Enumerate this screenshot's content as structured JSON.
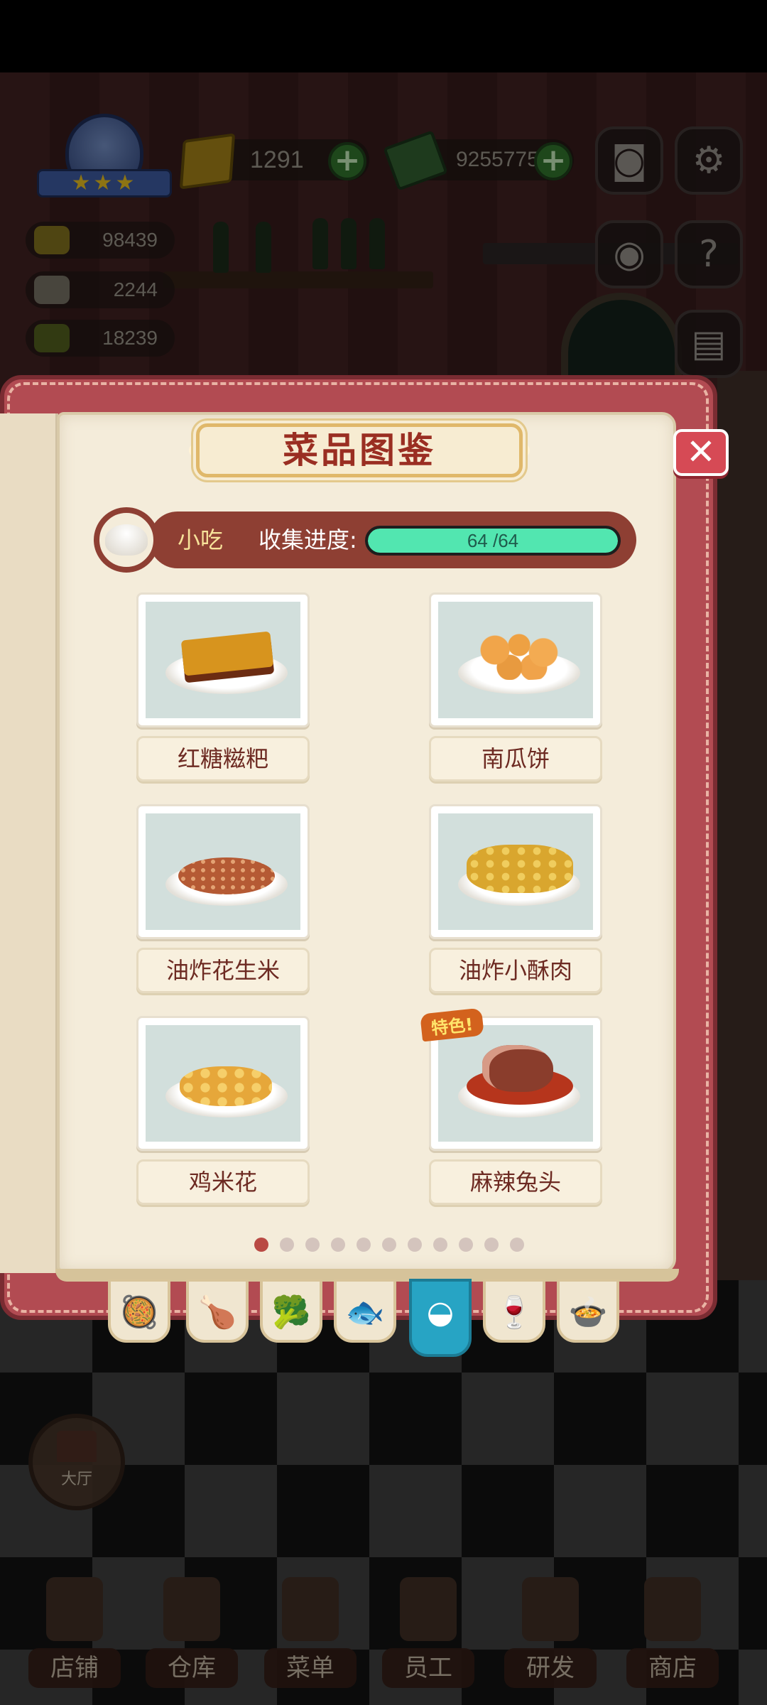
{
  "hud": {
    "gold": "1291",
    "cash": "9255775",
    "stats": [
      "98439",
      "2244",
      "18239"
    ],
    "badge_stars": "★★★",
    "icons": [
      "camera-icon",
      "gear-icon",
      "eye-icon",
      "help-book-icon",
      "recipe-book-icon"
    ]
  },
  "book": {
    "title": "菜品图鉴",
    "close": "✕",
    "category": "小吃",
    "progress_label": "收集进度:",
    "progress_current": "64",
    "progress_total": " /64",
    "progress_fraction": 1.0,
    "special_tag": "特色!",
    "dishes": [
      "红糖糍粑",
      "南瓜饼",
      "油炸花生米",
      "油炸小酥肉",
      "鸡米花",
      "麻辣兔头"
    ],
    "page_count": 11,
    "active_page": 1,
    "tabs": [
      {
        "icon": "wok-icon",
        "glyph": "🥘"
      },
      {
        "icon": "drumstick-icon",
        "glyph": "🍗"
      },
      {
        "icon": "broccoli-icon",
        "glyph": "🥦"
      },
      {
        "icon": "fish-icon",
        "glyph": "🐟"
      },
      {
        "icon": "bun-icon",
        "glyph": "◒"
      },
      {
        "icon": "wine-glass-icon",
        "glyph": "🍷"
      },
      {
        "icon": "soup-bowl-icon",
        "glyph": "🍲"
      }
    ],
    "active_tab": 4
  },
  "nav": {
    "hall": "大厅",
    "items": [
      "店铺",
      "仓库",
      "菜单",
      "员工",
      "研发",
      "商店"
    ]
  },
  "colors": {
    "accent": "#b24b52",
    "progress": "#52e6b0",
    "title": "#9a2e22",
    "active_tab": "#27a4c4"
  }
}
